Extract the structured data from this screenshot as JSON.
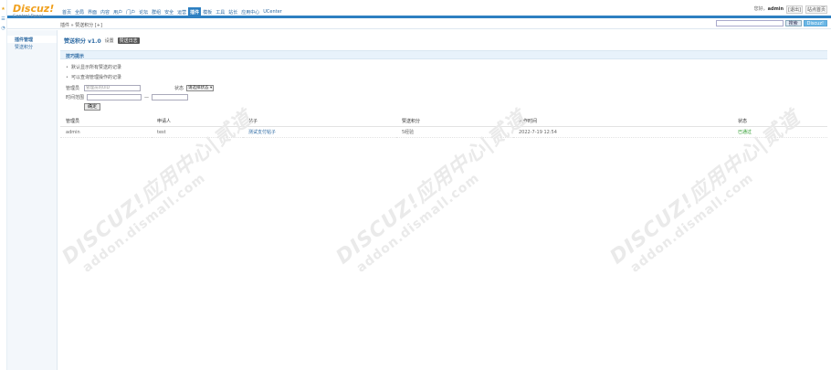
{
  "left_tools": [
    "★",
    "☰",
    "◔"
  ],
  "header": {
    "brand": "Discuz!",
    "brand_sub": "Control Panel",
    "nav": [
      {
        "label": "首页",
        "active": false
      },
      {
        "label": "全局",
        "active": false
      },
      {
        "label": "界面",
        "active": false
      },
      {
        "label": "内容",
        "active": false
      },
      {
        "label": "用户",
        "active": false
      },
      {
        "label": "门户",
        "active": false
      },
      {
        "label": "论坛",
        "active": false
      },
      {
        "label": "群组",
        "active": false
      },
      {
        "label": "安全",
        "active": false
      },
      {
        "label": "运营",
        "active": false
      },
      {
        "label": "插件",
        "active": true
      },
      {
        "label": "模板",
        "active": false
      },
      {
        "label": "工具",
        "active": false
      },
      {
        "label": "站长",
        "active": false
      },
      {
        "label": "应用中心",
        "active": false
      },
      {
        "label": "UCenter",
        "active": false
      }
    ],
    "user_prefix": "您好，",
    "user_name": "admin",
    "exit_label": "[退出]",
    "site_home_label": "站点首页"
  },
  "crumb": "插件 » 赞送积分 [+]",
  "search": {
    "placeholder": "",
    "btn1": "搜索",
    "btn2": "Discuz!"
  },
  "sidebar": {
    "items": [
      {
        "label": "插件管理",
        "active": true
      },
      {
        "label": "赞送积分",
        "active": false
      }
    ]
  },
  "main": {
    "title": "赞送积分 v1.0",
    "tabs": [
      {
        "label": "设置",
        "active": false
      },
      {
        "label": "赞送日志",
        "active": true
      }
    ],
    "tips_title": "技巧提示",
    "tips": [
      "默认显示所有赞送的记录",
      "可以查询管理操作的记录"
    ],
    "form": {
      "admin_label": "管理员",
      "admin_placeholder": "管理员的UID",
      "status_label": "状态",
      "status_value": "请选择状态 ▾",
      "time_label": "时间范围",
      "range_sep": "—",
      "ok_label": "确定"
    },
    "table": {
      "headers": [
        "管理员",
        "申请人",
        "帖子",
        "赞送积分",
        "操作时间",
        "状态"
      ],
      "rows": [
        {
          "admin": "admin",
          "applicant": "test",
          "post": "测试支付帖子",
          "credits": "5经验",
          "time": "2022-7-19 12:54",
          "status": "已通过"
        }
      ]
    }
  },
  "watermark": {
    "line1": "DISCUZ!应用中心|贰道",
    "line2": "addon.dismall.com"
  }
}
